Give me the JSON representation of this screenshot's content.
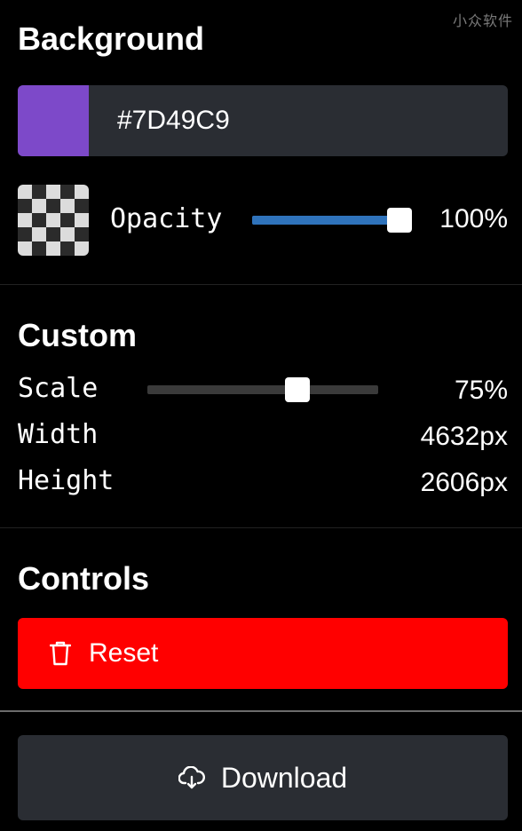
{
  "watermark": "小众软件",
  "background": {
    "heading": "Background",
    "color_hex": "#7D49C9",
    "swatch_color": "#7D49C9",
    "opacity_label": "Opacity",
    "opacity_value": "100%",
    "opacity_fraction": 1.0,
    "opacity_fill_color": "#2f73bb"
  },
  "custom": {
    "heading": "Custom",
    "scale_label": "Scale",
    "scale_value": "75%",
    "scale_fraction": 0.65,
    "width_label": "Width",
    "width_value": "4632px",
    "height_label": "Height",
    "height_value": "2606px"
  },
  "controls": {
    "heading": "Controls",
    "reset_label": "Reset",
    "reset_icon": "trash-icon",
    "reset_color": "#FF0000",
    "download_label": "Download",
    "download_icon": "cloud-download-icon"
  }
}
